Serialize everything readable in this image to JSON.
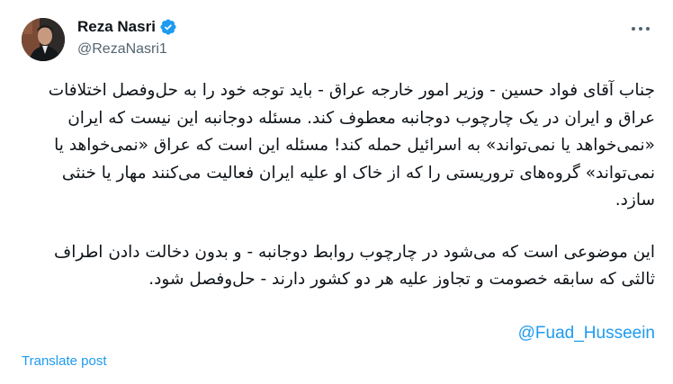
{
  "author": {
    "display_name": "Reza Nasri",
    "handle": "@RezaNasri1",
    "verified": true,
    "avatar_icon": "profile-photo"
  },
  "menu": {
    "icon": "more-horizontal-icon"
  },
  "tweet": {
    "paragraphs": [
      "جناب آقای فواد حسین - وزیر امور خارجه عراق - باید توجه خود را به حل‌وفصل اختلافات عراق و ایران در یک چارچوب دوجانبه معطوف کند. مسئله دوجانبه این نیست که ایران «نمی‌خواهد یا نمی‌تواند» به اسرائیل حمله کند! مسئله این است که عراق «نمی‌خواهد یا نمی‌تواند» گروه‌های تروریستی را که از خاک او علیه ایران فعالیت می‌کنند مهار یا خنثی سازد.",
      "این موضوعی است که می‌شود در چارچوب روابط دوجانبه - و بدون دخالت دادن اطراف ثالثی که سابقه خصومت و تجاوز علیه هر دو کشور دارند - حل‌وفصل شود."
    ],
    "mention": "@Fuad_Husseein"
  },
  "actions": {
    "translate_label": "Translate post"
  },
  "colors": {
    "link": "#1d9bf0",
    "verified": "#1d9bf0",
    "secondary_text": "#536471"
  }
}
